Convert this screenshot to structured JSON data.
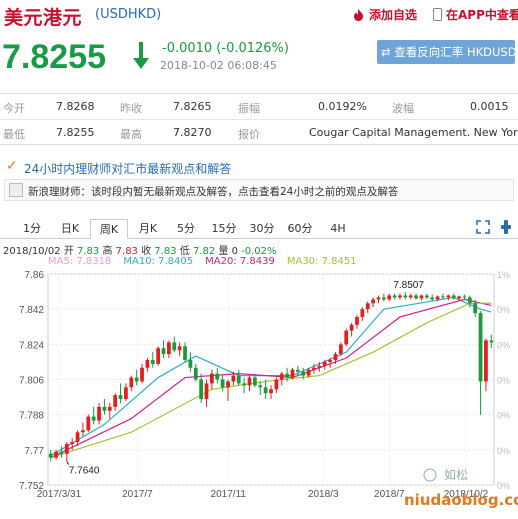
{
  "header": {
    "title": "美元港元",
    "code": "(USDHKD)",
    "add_fav": "添加自选",
    "app_view": "在APP中查看"
  },
  "quote": {
    "price": "7.8255",
    "change": "-0.0010 (-0.0126%)",
    "time": "2018-10-02 06:08:45",
    "reverse_button": "查看反向汇率 HKDUSD"
  },
  "stats": [
    {
      "label": "今开",
      "value": "7.8268"
    },
    {
      "label": "昨收",
      "value": "7.8265"
    },
    {
      "label": "振幅",
      "value": "0.0192%"
    },
    {
      "label": "波幅",
      "value": "0.0015"
    },
    {
      "label": "最低",
      "value": "7.8255"
    },
    {
      "label": "最高",
      "value": "7.8270"
    },
    {
      "label": "报价",
      "value": "Cougar Capital Management. New York"
    }
  ],
  "news": {
    "title": "24小时内理财师对汇市最新观点和解答",
    "text": "新浪理财师：该时段内暂无最新观点及解答，点击查看24小时之前的观点及解答"
  },
  "tabs": [
    "1分",
    "日K",
    "周K",
    "月K",
    "5分",
    "15分",
    "30分",
    "60分",
    "4H"
  ],
  "active_tab": "周K",
  "ohlc": {
    "date": "2018/10/02",
    "open_label": "开",
    "open": "7.83",
    "high_label": "高",
    "high": "7.83",
    "close_label": "收",
    "close": "7.83",
    "low_label": "低",
    "low": "7.82",
    "volume_label": "量",
    "volume": "0",
    "change_pct": "-0.02%"
  },
  "ma": [
    {
      "name": "MA5",
      "value": "7.8318",
      "color": "#f0a0c8"
    },
    {
      "name": "MA10",
      "value": "7.8405",
      "color": "#2ab0c8"
    },
    {
      "name": "MA20",
      "value": "7.8439",
      "color": "#d0208a"
    },
    {
      "name": "MA30",
      "value": "7.8451",
      "color": "#a8c030"
    }
  ],
  "watermark": {
    "name": "如松",
    "site": "niudaoblog.com"
  },
  "chart_data": {
    "type": "candlestick",
    "y_ticks": [
      "7.86",
      "7.842",
      "7.824",
      "7.806",
      "7.788",
      "7.77",
      "7.752"
    ],
    "ylim": [
      7.752,
      7.86
    ],
    "right_ticks": [
      "1%",
      "0%",
      "0%",
      "0%",
      "0%",
      "0%",
      "0%"
    ],
    "x_ticks": [
      "2017/3/31",
      "2017/7",
      "2017/11",
      "2018/3",
      "2018/7",
      "2018/10/2"
    ],
    "annotations": [
      {
        "text": "7.8507",
        "x_index": 66,
        "value": 7.8507
      },
      {
        "text": "7.7640",
        "x_index": 3,
        "value": 7.764
      }
    ],
    "colors": {
      "up": "#e02020",
      "down": "#1a9a3a"
    },
    "candles": [
      [
        7.768,
        7.77,
        7.764,
        7.766
      ],
      [
        7.766,
        7.77,
        7.765,
        7.769
      ],
      [
        7.769,
        7.772,
        7.766,
        7.768
      ],
      [
        7.768,
        7.774,
        7.764,
        7.773
      ],
      [
        7.773,
        7.776,
        7.77,
        7.774
      ],
      [
        7.774,
        7.78,
        7.772,
        7.779
      ],
      [
        7.779,
        7.784,
        7.777,
        7.78
      ],
      [
        7.78,
        7.788,
        7.779,
        7.787
      ],
      [
        7.787,
        7.792,
        7.783,
        7.785
      ],
      [
        7.785,
        7.794,
        7.783,
        7.792
      ],
      [
        7.792,
        7.796,
        7.788,
        7.79
      ],
      [
        7.79,
        7.794,
        7.786,
        7.792
      ],
      [
        7.792,
        7.799,
        7.79,
        7.798
      ],
      [
        7.798,
        7.804,
        7.794,
        7.796
      ],
      [
        7.796,
        7.804,
        7.795,
        7.802
      ],
      [
        7.802,
        7.808,
        7.8,
        7.807
      ],
      [
        7.807,
        7.811,
        7.803,
        7.805
      ],
      [
        7.805,
        7.814,
        7.804,
        7.812
      ],
      [
        7.812,
        7.817,
        7.81,
        7.816
      ],
      [
        7.816,
        7.82,
        7.812,
        7.814
      ],
      [
        7.814,
        7.823,
        7.813,
        7.822
      ],
      [
        7.822,
        7.826,
        7.817,
        7.819
      ],
      [
        7.819,
        7.826,
        7.817,
        7.825
      ],
      [
        7.825,
        7.828,
        7.82,
        7.821
      ],
      [
        7.821,
        7.825,
        7.818,
        7.823
      ],
      [
        7.823,
        7.825,
        7.815,
        7.816
      ],
      [
        7.816,
        7.82,
        7.81,
        7.812
      ],
      [
        7.812,
        7.814,
        7.805,
        7.806
      ],
      [
        7.806,
        7.809,
        7.794,
        7.796
      ],
      [
        7.796,
        7.806,
        7.792,
        7.804
      ],
      [
        7.804,
        7.811,
        7.801,
        7.809
      ],
      [
        7.809,
        7.812,
        7.804,
        7.806
      ],
      [
        7.806,
        7.808,
        7.8,
        7.802
      ],
      [
        7.802,
        7.806,
        7.795,
        7.805
      ],
      [
        7.805,
        7.81,
        7.803,
        7.808
      ],
      [
        7.808,
        7.811,
        7.803,
        7.804
      ],
      [
        7.804,
        7.807,
        7.799,
        7.803
      ],
      [
        7.803,
        7.808,
        7.8,
        7.807
      ],
      [
        7.807,
        7.809,
        7.802,
        7.803
      ],
      [
        7.803,
        7.805,
        7.798,
        7.802
      ],
      [
        7.802,
        7.806,
        7.796,
        7.799
      ],
      [
        7.799,
        7.803,
        7.796,
        7.801
      ],
      [
        7.801,
        7.807,
        7.799,
        7.806
      ],
      [
        7.806,
        7.81,
        7.803,
        7.809
      ],
      [
        7.809,
        7.812,
        7.805,
        7.807
      ],
      [
        7.807,
        7.812,
        7.806,
        7.811
      ],
      [
        7.811,
        7.813,
        7.808,
        7.81
      ],
      [
        7.81,
        7.812,
        7.806,
        7.808
      ],
      [
        7.808,
        7.812,
        7.807,
        7.811
      ],
      [
        7.811,
        7.814,
        7.809,
        7.812
      ],
      [
        7.812,
        7.815,
        7.81,
        7.813
      ],
      [
        7.813,
        7.816,
        7.811,
        7.815
      ],
      [
        7.815,
        7.817,
        7.812,
        7.816
      ],
      [
        7.816,
        7.82,
        7.814,
        7.819
      ],
      [
        7.819,
        7.825,
        7.818,
        7.824
      ],
      [
        7.824,
        7.832,
        7.823,
        7.831
      ],
      [
        7.831,
        7.835,
        7.828,
        7.834
      ],
      [
        7.834,
        7.839,
        7.832,
        7.838
      ],
      [
        7.838,
        7.843,
        7.836,
        7.842
      ],
      [
        7.842,
        7.846,
        7.84,
        7.845
      ],
      [
        7.845,
        7.848,
        7.843,
        7.847
      ],
      [
        7.847,
        7.849,
        7.845,
        7.848
      ],
      [
        7.848,
        7.85,
        7.846,
        7.847
      ],
      [
        7.847,
        7.85,
        7.846,
        7.849
      ],
      [
        7.849,
        7.85,
        7.847,
        7.848
      ],
      [
        7.848,
        7.85,
        7.847,
        7.849
      ],
      [
        7.849,
        7.8507,
        7.847,
        7.848
      ],
      [
        7.848,
        7.85,
        7.847,
        7.849
      ],
      [
        7.849,
        7.85,
        7.847,
        7.8475
      ],
      [
        7.8475,
        7.8495,
        7.8465,
        7.849
      ],
      [
        7.849,
        7.85,
        7.847,
        7.848
      ],
      [
        7.848,
        7.8495,
        7.846,
        7.847
      ],
      [
        7.847,
        7.849,
        7.846,
        7.8485
      ],
      [
        7.8485,
        7.85,
        7.847,
        7.848
      ],
      [
        7.848,
        7.8495,
        7.8465,
        7.849
      ],
      [
        7.849,
        7.85,
        7.847,
        7.8475
      ],
      [
        7.8475,
        7.849,
        7.846,
        7.8485
      ],
      [
        7.8485,
        7.8495,
        7.847,
        7.848
      ],
      [
        7.848,
        7.849,
        7.843,
        7.845
      ],
      [
        7.845,
        7.847,
        7.838,
        7.84
      ],
      [
        7.84,
        7.841,
        7.788,
        7.805
      ],
      [
        7.805,
        7.827,
        7.8,
        7.826
      ],
      [
        7.826,
        7.829,
        7.822,
        7.825
      ]
    ],
    "ma_lines": {
      "MA10": [
        [
          0,
          7.767
        ],
        [
          10,
          7.783
        ],
        [
          20,
          7.807
        ],
        [
          27,
          7.818
        ],
        [
          35,
          7.808
        ],
        [
          45,
          7.808
        ],
        [
          55,
          7.82
        ],
        [
          62,
          7.842
        ],
        [
          75,
          7.848
        ],
        [
          80,
          7.842
        ],
        [
          82,
          7.8405
        ]
      ],
      "MA20": [
        [
          0,
          7.766
        ],
        [
          15,
          7.786
        ],
        [
          25,
          7.807
        ],
        [
          35,
          7.809
        ],
        [
          45,
          7.807
        ],
        [
          55,
          7.817
        ],
        [
          65,
          7.838
        ],
        [
          77,
          7.847
        ],
        [
          82,
          7.8439
        ]
      ],
      "MA30": [
        [
          0,
          7.766
        ],
        [
          15,
          7.779
        ],
        [
          30,
          7.801
        ],
        [
          40,
          7.805
        ],
        [
          50,
          7.808
        ],
        [
          60,
          7.82
        ],
        [
          70,
          7.835
        ],
        [
          78,
          7.845
        ],
        [
          82,
          7.8451
        ]
      ]
    }
  }
}
